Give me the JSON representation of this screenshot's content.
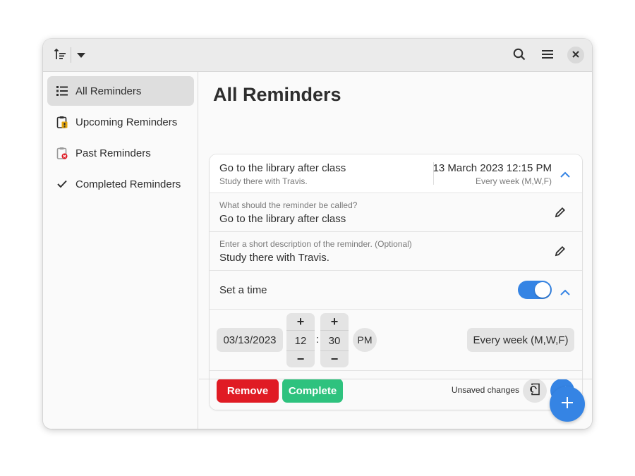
{
  "window": {
    "title": "All Reminders"
  },
  "headerbar": {
    "sort_icon": "sort-icon",
    "dropdown_icon": "chevron-down-icon",
    "search_icon": "search-icon",
    "menu_icon": "hamburger-menu-icon",
    "close_icon": "close-icon"
  },
  "sidebar": {
    "items": [
      {
        "label": "All Reminders",
        "icon": "list-icon",
        "active": true
      },
      {
        "label": "Upcoming Reminders",
        "icon": "clipboard-clock-icon",
        "active": false
      },
      {
        "label": "Past Reminders",
        "icon": "clipboard-x-icon",
        "active": false
      },
      {
        "label": "Completed Reminders",
        "icon": "checkmark-icon",
        "active": false
      }
    ]
  },
  "main": {
    "title": "All Reminders",
    "reminder": {
      "title": "Go to the library after class",
      "subtitle": "Study there with Travis.",
      "datetime": "13 March 2023 12:15 PM",
      "repeat": "Every week (M,W,F)",
      "name_field": {
        "label": "What should the reminder be called?",
        "value": "Go to the library after class"
      },
      "description_field": {
        "label": "Enter a short description of the reminder. (Optional)",
        "value": "Study there with Travis."
      },
      "set_time": {
        "label": "Set a time",
        "enabled": true
      },
      "date_value": "03/13/2023",
      "hour": "12",
      "minute": "30",
      "separator": ":",
      "ampm": "PM",
      "plus_label": "+",
      "minus_label": "−",
      "repeat_button": "Every week (M,W,F)",
      "remove_label": "Remove",
      "complete_label": "Complete",
      "unsaved_label": "Unsaved changes"
    }
  },
  "colors": {
    "accent": "#3584e4",
    "destructive": "#e01b24",
    "success": "#2ec27e",
    "warning_icon": "#e5a50a",
    "error_icon": "#e01b24"
  }
}
